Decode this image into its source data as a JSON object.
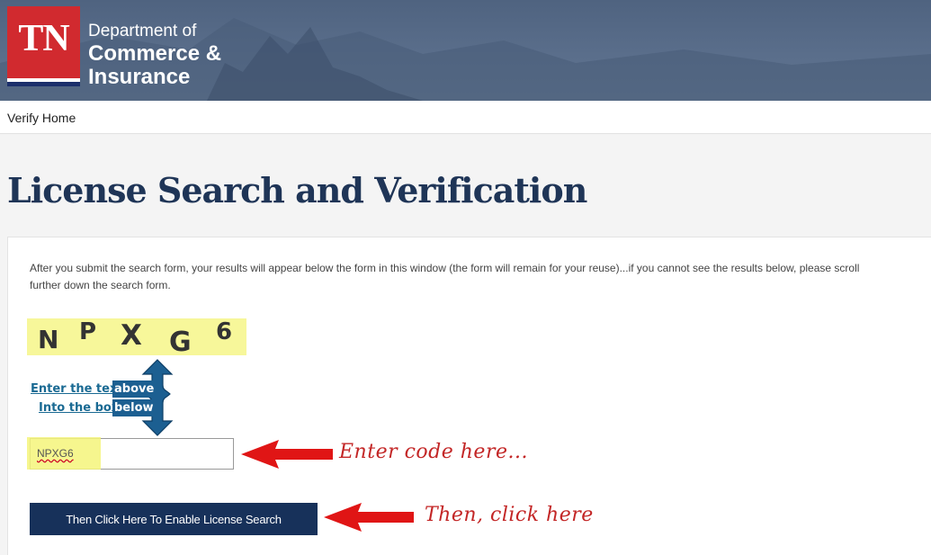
{
  "header": {
    "logo_text": "TN",
    "dept_line1": "Department of",
    "dept_line2": "Commerce &",
    "dept_line3": "Insurance"
  },
  "nav": {
    "home_link": "Verify Home"
  },
  "page": {
    "title": "License Search and Verification",
    "intro_line1": "After you submit the search form, your results will appear below the form in this window (the form will remain for your reuse)...if you cannot see the results below, please scroll",
    "intro_line2": "further down the search form."
  },
  "captcha": {
    "chars": [
      "N",
      "P",
      "X",
      "G",
      "6"
    ]
  },
  "instructions": {
    "line1_link": "Enter the text",
    "line1_badge": "above",
    "line2_link": "Into the box",
    "line2_badge": "below"
  },
  "form": {
    "code_value": "NPXG6",
    "enable_button": "Then Click Here To Enable License Search"
  },
  "annotations": {
    "enter_code": "Enter code here...",
    "click_here": "Then, click here"
  },
  "colors": {
    "header_bg": "#56698a",
    "logo_red": "#d12a2f",
    "title": "#1f3557",
    "button": "#17315a",
    "annotation_red": "#c32626",
    "highlight_yellow": "#f7f79a"
  }
}
